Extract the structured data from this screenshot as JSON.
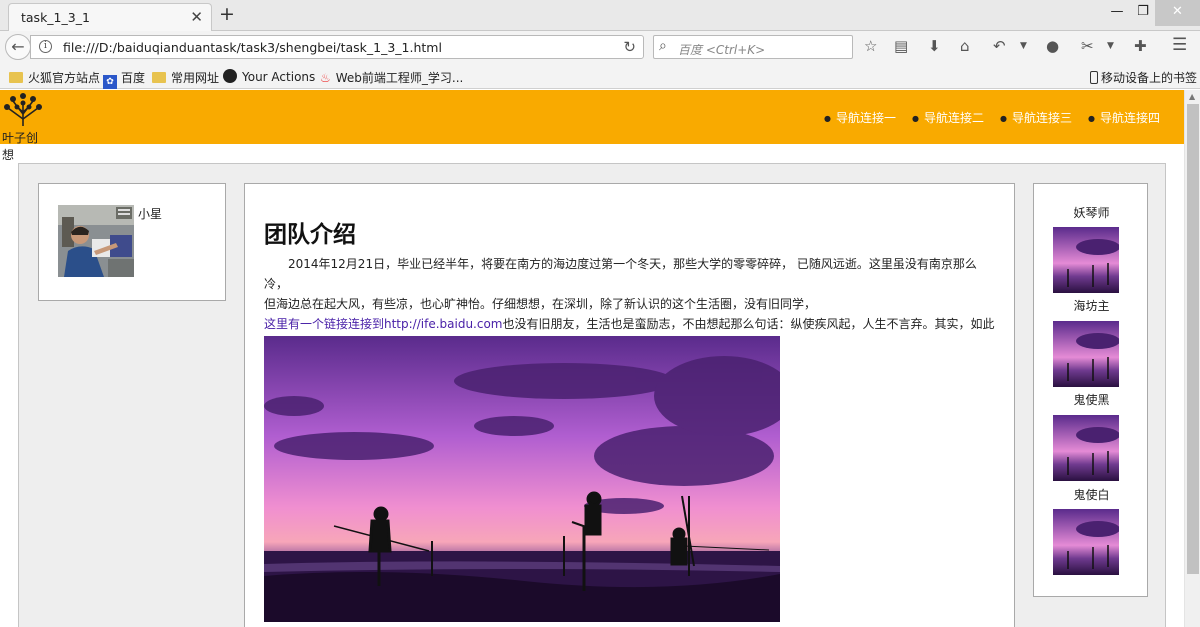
{
  "browser": {
    "tab_title": "task_1_3_1",
    "url": "file:///D:/baiduqianduantask/task3/shengbei/task_1_3_1.html",
    "search_placeholder": "百度 <Ctrl+K>",
    "bookmarks": [
      "火狐官方站点",
      "百度",
      "常用网址",
      "Your Actions",
      "Web前端工程师_学习..."
    ],
    "mobile_bookmarks": "移动设备上的书签"
  },
  "site": {
    "logo_text": "叶子创想",
    "brand_color": "#f9aa00",
    "nav": [
      "导航连接一",
      "导航连接二",
      "导航连接三",
      "导航连接四"
    ]
  },
  "left": {
    "author": "小星"
  },
  "main": {
    "title": "团队介绍",
    "para1": "2014年12月21日，毕业已经半年，将要在南方的海边度过第一个冬天，那些大学的零零碎碎， 已随风远逝。这里虽没有南京那么冷，",
    "para2": "但海边总在起大风，有些凉，也心旷神怡。仔细想想，在深圳，除了新认识的这个生活圈，没有旧同学，",
    "link_text": "这里有一个链接连接到http://ife.baidu.com",
    "para3": "也没有旧朋友，生活也是蛮励志，不由想起那么句话：纵使疾风起，人生不言弃。其实，如此抛开以往的所有，重新开始一段新的旅程， 少了很多无聊的来往，生活突然变得轻松简单。"
  },
  "right": {
    "members": [
      "妖琴师",
      "海坊主",
      "鬼使黑",
      "鬼使白"
    ]
  }
}
